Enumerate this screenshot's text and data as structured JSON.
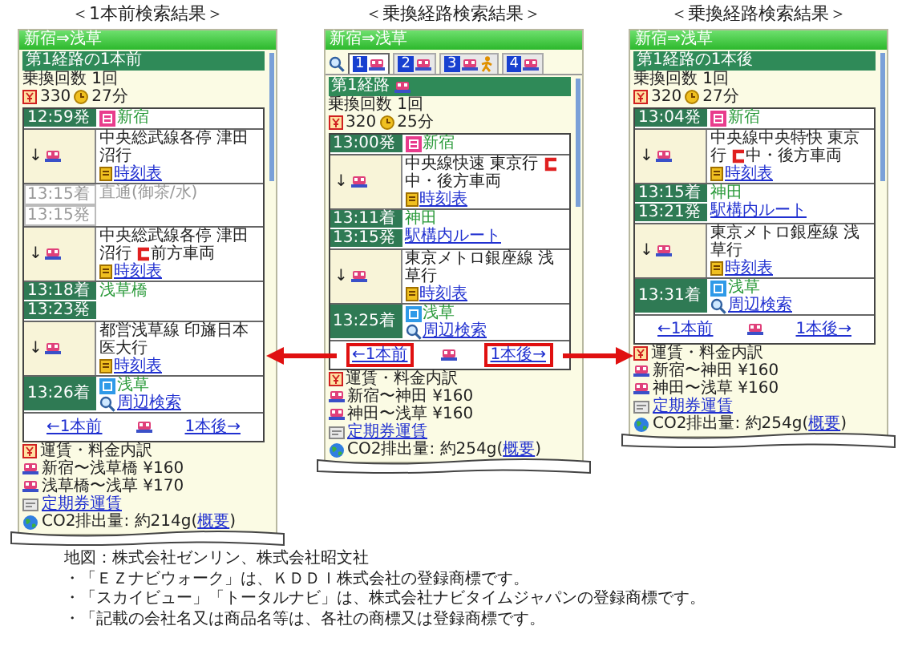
{
  "panels": [
    {
      "heading": "＜1本前検索結果＞",
      "title": "新宿⇒浅草",
      "route_label": "第1経路の1本前",
      "route_train": false,
      "transfers": "乗換回数 1回",
      "fare": "330",
      "duration": "27分",
      "segments": [
        {
          "kind": "station",
          "times": [
            "12:59発"
          ],
          "origin": true,
          "destination": false,
          "name": "新宿",
          "through": false
        },
        {
          "kind": "ride",
          "arrow": "↓",
          "line": "中央総武線各停 津田沼行",
          "timetable": "時刻表"
        },
        {
          "kind": "station",
          "times": [
            "13:15着",
            "13:15発"
          ],
          "origin": false,
          "destination": false,
          "name": "直通(御茶/水)",
          "through": true
        },
        {
          "kind": "ride",
          "arrow": "↓",
          "line": "中央総武線各停 津田沼行",
          "car": "前方車両",
          "timetable": "時刻表"
        },
        {
          "kind": "station",
          "times": [
            "13:18着",
            "13:23発"
          ],
          "origin": false,
          "destination": false,
          "name": "浅草橋",
          "through": false
        },
        {
          "kind": "ride",
          "arrow": "↓",
          "line": "都営浅草線 印旛日本医大行",
          "timetable": "時刻表"
        },
        {
          "kind": "station",
          "times": [
            "13:26着"
          ],
          "origin": false,
          "destination": true,
          "name": "浅草",
          "link": "周辺検索",
          "through": false
        }
      ],
      "nav": {
        "prev": "←1本前",
        "next": "1本後→",
        "highlight": false
      },
      "breakdown": "運賃・料金内訳",
      "fares": [
        "新宿〜浅草橋 ¥160",
        "浅草橋〜浅草 ¥170"
      ],
      "commuter": "定期券運賃",
      "co2": "CO2排出量: 約214g(",
      "co2_link": "概要",
      "co2_end": ")"
    },
    {
      "heading": "＜乗換経路検索結果＞",
      "title": "新宿⇒浅草",
      "tabs": [
        {
          "number": "1",
          "selected": true,
          "walk": false
        },
        {
          "number": "2",
          "selected": false,
          "walk": false
        },
        {
          "number": "3",
          "selected": false,
          "walk": true
        },
        {
          "number": "4",
          "selected": false,
          "walk": false
        }
      ],
      "route_label": "第1経路",
      "route_train": true,
      "transfers": "乗換回数 1回",
      "fare": "320",
      "duration": "25分",
      "segments": [
        {
          "kind": "station",
          "times": [
            "13:00発"
          ],
          "origin": true,
          "destination": false,
          "name": "新宿",
          "through": false
        },
        {
          "kind": "ride",
          "arrow": "↓",
          "line": "中央線快速 東京行",
          "car": "中・後方車両",
          "timetable": "時刻表"
        },
        {
          "kind": "station",
          "times": [
            "13:11着",
            "13:15発"
          ],
          "origin": false,
          "destination": false,
          "name": "神田",
          "link": "駅構内ルート",
          "through": false
        },
        {
          "kind": "ride",
          "arrow": "↓",
          "line": "東京メトロ銀座線 浅草行",
          "timetable": "時刻表"
        },
        {
          "kind": "station",
          "times": [
            "13:25着"
          ],
          "origin": false,
          "destination": true,
          "name": "浅草",
          "link": "周辺検索",
          "through": false
        }
      ],
      "nav": {
        "prev": "←1本前",
        "next": "1本後→",
        "highlight": true
      },
      "breakdown": "運賃・料金内訳",
      "fares": [
        "新宿〜神田 ¥160",
        "神田〜浅草 ¥160"
      ],
      "commuter": "定期券運賃",
      "co2": "CO2排出量: 約254g(",
      "co2_link": "概要",
      "co2_end": ")"
    },
    {
      "heading": "＜乗換経路検索結果＞",
      "title": "新宿⇒浅草",
      "route_label": "第1経路の1本後",
      "route_train": false,
      "transfers": "乗換回数 1回",
      "fare": "320",
      "duration": "27分",
      "segments": [
        {
          "kind": "station",
          "times": [
            "13:04発"
          ],
          "origin": true,
          "destination": false,
          "name": "新宿",
          "through": false
        },
        {
          "kind": "ride",
          "arrow": "↓",
          "line": "中央線中央特快 東京行",
          "car": "中・後方車両",
          "timetable": "時刻表"
        },
        {
          "kind": "station",
          "times": [
            "13:15着",
            "13:21発"
          ],
          "origin": false,
          "destination": false,
          "name": "神田",
          "link": "駅構内ルート",
          "through": false
        },
        {
          "kind": "ride",
          "arrow": "↓",
          "line": "東京メトロ銀座線 浅草行",
          "timetable": "時刻表"
        },
        {
          "kind": "station",
          "times": [
            "13:31着"
          ],
          "origin": false,
          "destination": true,
          "name": "浅草",
          "link": "周辺検索",
          "through": false
        }
      ],
      "nav": {
        "prev": "←1本前",
        "next": "1本後→",
        "highlight": false
      },
      "breakdown": "運賃・料金内訳",
      "fares": [
        "新宿〜神田 ¥160",
        "神田〜浅草 ¥160"
      ],
      "commuter": "定期券運賃",
      "co2": "CO2排出量: 約254g(",
      "co2_link": "概要",
      "co2_end": ")"
    }
  ],
  "notes": [
    "地図：株式会社ゼンリン、株式会社昭文社",
    "・「ＥＺナビウォーク」は、ＫＤＤＩ株式会社の登録商標です。",
    "・「スカイビュー」「トータルナビ」は、株式会社ナビタイムジャパンの登録商標です。",
    "・「記載の会社名又は商品名等は、各社の商標又は登録商標です。"
  ]
}
